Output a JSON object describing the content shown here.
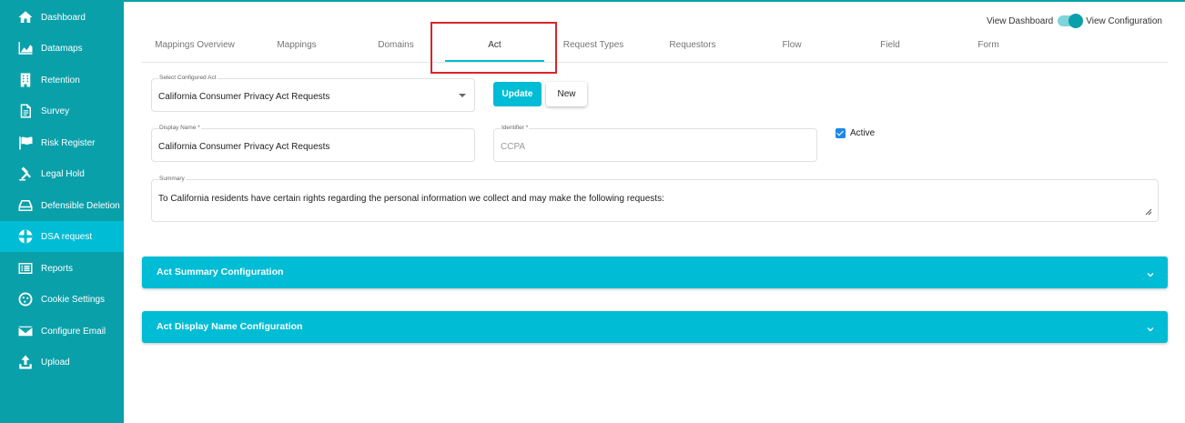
{
  "sidebar": {
    "items": [
      {
        "label": "Dashboard",
        "icon": "home-icon"
      },
      {
        "label": "Datamaps",
        "icon": "area-chart-icon"
      },
      {
        "label": "Retention",
        "icon": "building-icon"
      },
      {
        "label": "Survey",
        "icon": "document-icon"
      },
      {
        "label": "Risk Register",
        "icon": "flag-icon"
      },
      {
        "label": "Legal Hold",
        "icon": "gavel-icon"
      },
      {
        "label": "Defensible Deletion",
        "icon": "drive-icon"
      },
      {
        "label": "DSA request",
        "icon": "lifebuoy-icon"
      },
      {
        "label": "Reports",
        "icon": "list-icon"
      },
      {
        "label": "Cookie Settings",
        "icon": "cookie-icon"
      },
      {
        "label": "Configure Email",
        "icon": "envelope-icon"
      },
      {
        "label": "Upload",
        "icon": "upload-icon"
      }
    ],
    "active": "DSA request"
  },
  "view_toggle": {
    "left_label": "View Dashboard",
    "right_label": "View Configuration"
  },
  "tabs": [
    {
      "label": "Mappings Overview"
    },
    {
      "label": "Mappings"
    },
    {
      "label": "Domains"
    },
    {
      "label": "Act"
    },
    {
      "label": "Request Types"
    },
    {
      "label": "Requestors"
    },
    {
      "label": "Flow"
    },
    {
      "label": "Field"
    },
    {
      "label": "Form"
    }
  ],
  "active_tab": "Act",
  "form": {
    "select_act": {
      "label": "Select Configured Act",
      "value": "California Consumer Privacy Act Requests"
    },
    "update_label": "Update",
    "new_label": "New",
    "display_name": {
      "label": "Display Name *",
      "value": "California Consumer Privacy Act Requests"
    },
    "identifier": {
      "label": "Identifier *",
      "value": "CCPA"
    },
    "active_label": "Active",
    "summary": {
      "label": "Summary",
      "value": "To California residents have certain rights regarding the personal information we collect and may make the following requests:"
    }
  },
  "accordions": [
    {
      "title": "Act Summary Configuration"
    },
    {
      "title": "Act Display Name Configuration"
    }
  ],
  "colors": {
    "sidebar_bg": "#0aa0aa",
    "accent": "#00bcd4",
    "highlight": "#d9252a",
    "checkbox": "#1e88e5"
  }
}
